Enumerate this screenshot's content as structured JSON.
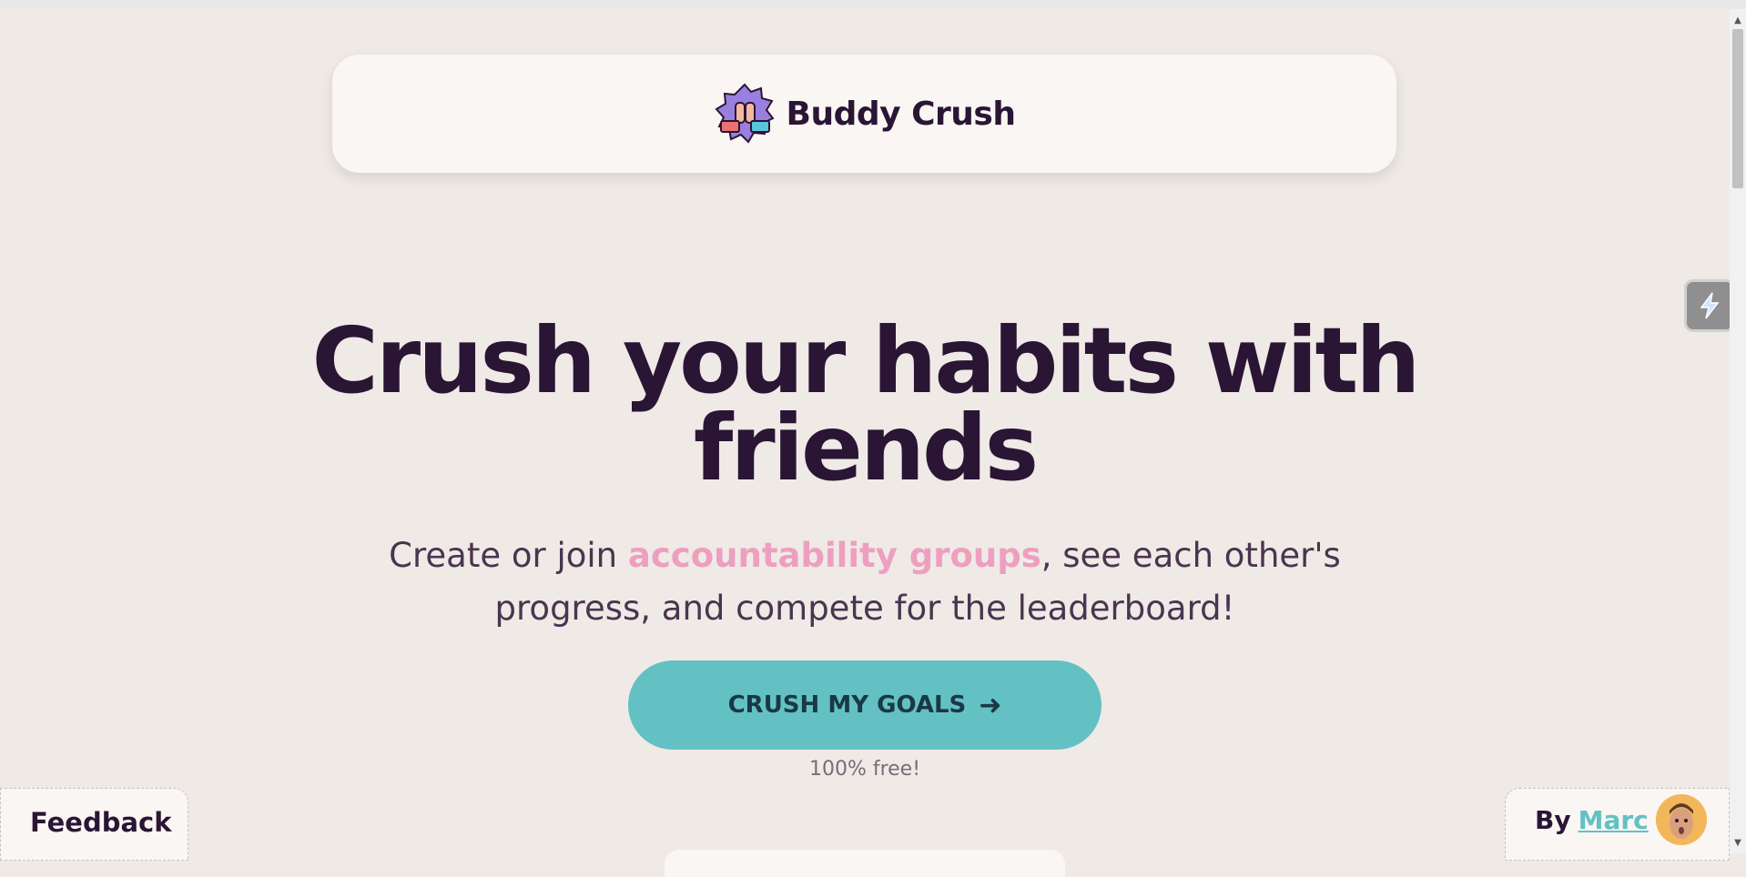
{
  "brand": {
    "name": "Buddy Crush",
    "logo_icon": "high-five-badge-icon"
  },
  "hero": {
    "title": "Crush your habits with friends",
    "subtitle_pre": "Create or join ",
    "subtitle_highlight": "accountability groups",
    "subtitle_post": ", see each other's progress, and compete for the leaderboard!"
  },
  "cta": {
    "label": "CRUSH MY GOALS",
    "icon": "arrow-right-icon",
    "note": "100% free!"
  },
  "feedback": {
    "label": "Feedback"
  },
  "author": {
    "by": "By",
    "name": "Marc",
    "avatar_icon": "avatar"
  },
  "side_widget": {
    "icon": "lightning-icon"
  },
  "colors": {
    "background": "#efeae6",
    "card": "#faf6f3",
    "accent": "#63c1c4",
    "highlight": "#ee9fbf",
    "text": "#2a1535"
  }
}
